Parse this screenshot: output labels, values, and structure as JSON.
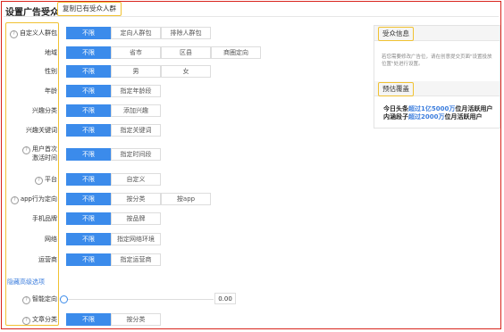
{
  "header": {
    "title": "设置广告受众",
    "copy_button": "复制已有受众人群"
  },
  "rows": [
    {
      "label": "自定义人群包",
      "help": true,
      "options": [
        "不限",
        "定向人群包",
        "排除人群包"
      ],
      "active": 0
    },
    {
      "label": "地域",
      "help": false,
      "options": [
        "不限",
        "省市",
        "区县",
        "商圈定向"
      ],
      "active": 0
    },
    {
      "label": "性别",
      "help": false,
      "options": [
        "不限",
        "男",
        "女"
      ],
      "active": 0
    },
    {
      "label": "年龄",
      "help": false,
      "options": [
        "不限",
        "指定年龄段"
      ],
      "active": 0
    },
    {
      "label": "兴趣分类",
      "help": false,
      "options": [
        "不限",
        "添加兴趣"
      ],
      "active": 0
    },
    {
      "label": "兴趣关键词",
      "help": false,
      "options": [
        "不限",
        "指定关键词"
      ],
      "active": 0
    },
    {
      "label": "用户首次\n激活时间",
      "help": true,
      "options": [
        "不限",
        "指定时间段"
      ],
      "active": 0
    },
    {
      "label": "平台",
      "help": true,
      "options": [
        "不限",
        "自定义"
      ],
      "active": 0
    },
    {
      "label": "app行为定向",
      "help": true,
      "options": [
        "不限",
        "按分类",
        "按app"
      ],
      "active": 0
    },
    {
      "label": "手机品牌",
      "help": false,
      "options": [
        "不限",
        "按品牌"
      ],
      "active": 0
    },
    {
      "label": "网络",
      "help": false,
      "options": [
        "不限",
        "指定网络环境"
      ],
      "active": 0
    },
    {
      "label": "运营商",
      "help": false,
      "options": [
        "不限",
        "指定运营商"
      ],
      "active": 0
    }
  ],
  "hidden_options_link": "隐藏高级选项",
  "smart_targeting": {
    "label": "智能定向",
    "value": "0.00",
    "level": 0
  },
  "article_category": {
    "label": "文章分类",
    "options": [
      "不限",
      "按分类"
    ],
    "active": 0
  },
  "side_panel": {
    "info_title": "受众信息",
    "info_note": "若您需要修改广告位，请在创意提交页面\"设置投放位置\"处进行设置。",
    "coverage_title": "预估覆盖",
    "coverage_line1_prefix": "今日头条",
    "coverage_line1_hl": "超过1亿5000万",
    "coverage_line1_suffix": "位月活跃用户",
    "coverage_line2_prefix": "内涵段子",
    "coverage_line2_hl": "超过2000万",
    "coverage_line2_suffix": "位月活跃用户"
  },
  "colors": {
    "accent": "#3b8beb",
    "highlight": "#f1c232",
    "frame": "#d9241c",
    "link": "#3b7ddd"
  }
}
